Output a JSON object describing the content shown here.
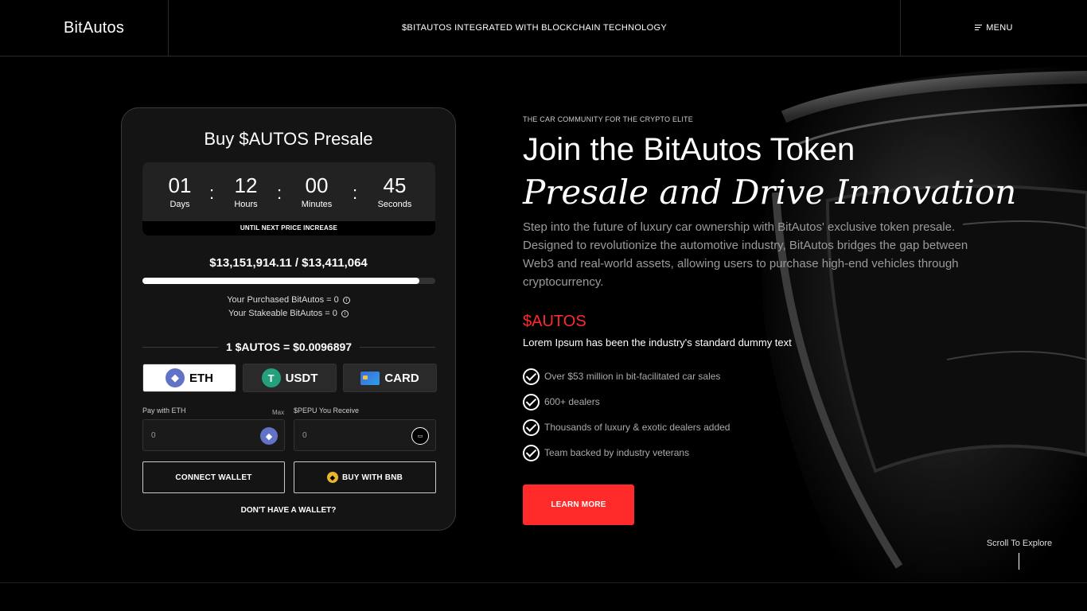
{
  "header": {
    "logo": "BitAutos",
    "tagline": "$BITAUTOS INTEGRATED WITH BLOCKCHAIN TECHNOLOGY",
    "menu_label": "MENU"
  },
  "presale": {
    "title": "Buy $AUTOS Presale",
    "countdown": {
      "days": "01",
      "days_label": "Days",
      "hours": "12",
      "hours_label": "Hours",
      "minutes": "00",
      "minutes_label": "Minutes",
      "seconds": "45",
      "seconds_label": "Seconds",
      "footer": "UNTIL NEXT PRICE INCREASE"
    },
    "raised": "$13,151,914.11 / $13,411,064",
    "progress_fraction": 0.945,
    "purchased": "Your Purchased BitAutos = 0",
    "stakeable": "Your Stakeable BitAutos = 0",
    "rate": "1 $AUTOS = $0.0096897",
    "tabs": [
      {
        "label": "ETH",
        "icon": "eth-icon",
        "active": true
      },
      {
        "label": "USDT",
        "icon": "usdt-icon",
        "active": false
      },
      {
        "label": "CARD",
        "icon": "card-icon",
        "active": false
      }
    ],
    "pay_label": "Pay with ETH",
    "max_label": "Max",
    "receive_label": "$PEPU You Receive",
    "pay_value": "0",
    "receive_value": "0",
    "connect_wallet": "CONNECT WALLET",
    "buy_bnb": "BUY WITH BNB",
    "no_wallet": "DON'T HAVE A WALLET?"
  },
  "hero": {
    "eyebrow": "THE CAR COMMUNITY FOR THE CRYPTO ELITE",
    "title_line1": "Join the BitAutos Token",
    "title_line2": "Presale and Drive Innovation",
    "description": "Step into the future of luxury car ownership with BitAutos' exclusive token presale. Designed to revolutionize the automotive industry, BitAutos bridges the gap between Web3 and real-world assets, allowing users to purchase high-end vehicles through cryptocurrency.",
    "ticker": "$AUTOS",
    "subtitle": "Lorem Ipsum has been the industry's standard dummy text",
    "features": [
      "Over $53 million in bit-facilitated car sales",
      "600+ dealers",
      "Thousands of luxury & exotic dealers added",
      "Team backed by industry veterans"
    ],
    "cta": "LEARN MORE"
  },
  "scroll_label": "Scroll To Explore",
  "colors": {
    "accent": "#ff2a2a",
    "background": "#000000",
    "card": "#141414"
  }
}
